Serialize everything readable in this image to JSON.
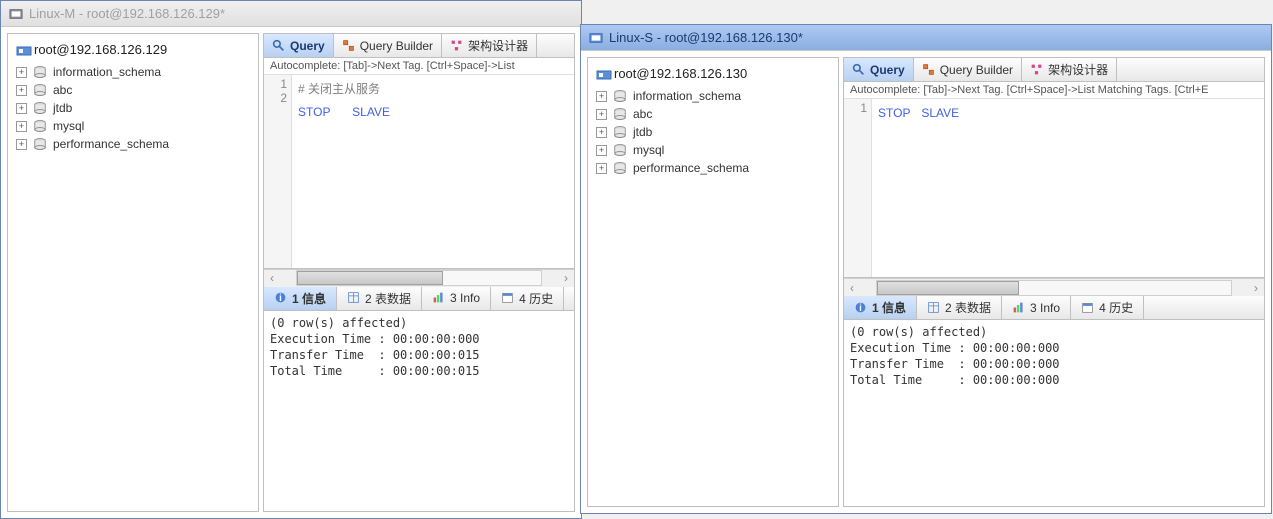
{
  "left": {
    "title": "Linux-M - root@192.168.126.129*",
    "active": false,
    "conn": "root@192.168.126.129",
    "dbs": [
      "information_schema",
      "abc",
      "jtdb",
      "mysql",
      "performance_schema"
    ],
    "tabs": {
      "query": "Query",
      "builder": "Query Builder",
      "schema": "架构设计器"
    },
    "autocomplete": "Autocomplete: [Tab]->Next Tag. [Ctrl+Space]->List",
    "lines": [
      "1",
      "2"
    ],
    "code_comment": "# 关闭主从服务",
    "code_kw1": "STOP",
    "code_kw2": "SLAVE",
    "result_tabs": {
      "info1": "1 信息",
      "data": "2 表数据",
      "info3": "3 Info",
      "history": "4 历史"
    },
    "result": "(0 row(s) affected)\nExecution Time : 00:00:00:000\nTransfer Time  : 00:00:00:015\nTotal Time     : 00:00:00:015"
  },
  "right": {
    "title": "Linux-S - root@192.168.126.130*",
    "active": true,
    "conn": "root@192.168.126.130",
    "dbs": [
      "information_schema",
      "abc",
      "jtdb",
      "mysql",
      "performance_schema"
    ],
    "tabs": {
      "query": "Query",
      "builder": "Query Builder",
      "schema": "架构设计器"
    },
    "autocomplete": "Autocomplete: [Tab]->Next Tag. [Ctrl+Space]->List Matching Tags. [Ctrl+E",
    "lines": [
      "1"
    ],
    "code_kw1": "STOP",
    "code_kw2": "SLAVE",
    "result_tabs": {
      "info1": "1 信息",
      "data": "2 表数据",
      "info3": "3 Info",
      "history": "4 历史"
    },
    "result": "(0 row(s) affected)\nExecution Time : 00:00:00:000\nTransfer Time  : 00:00:00:000\nTotal Time     : 00:00:00:000"
  }
}
